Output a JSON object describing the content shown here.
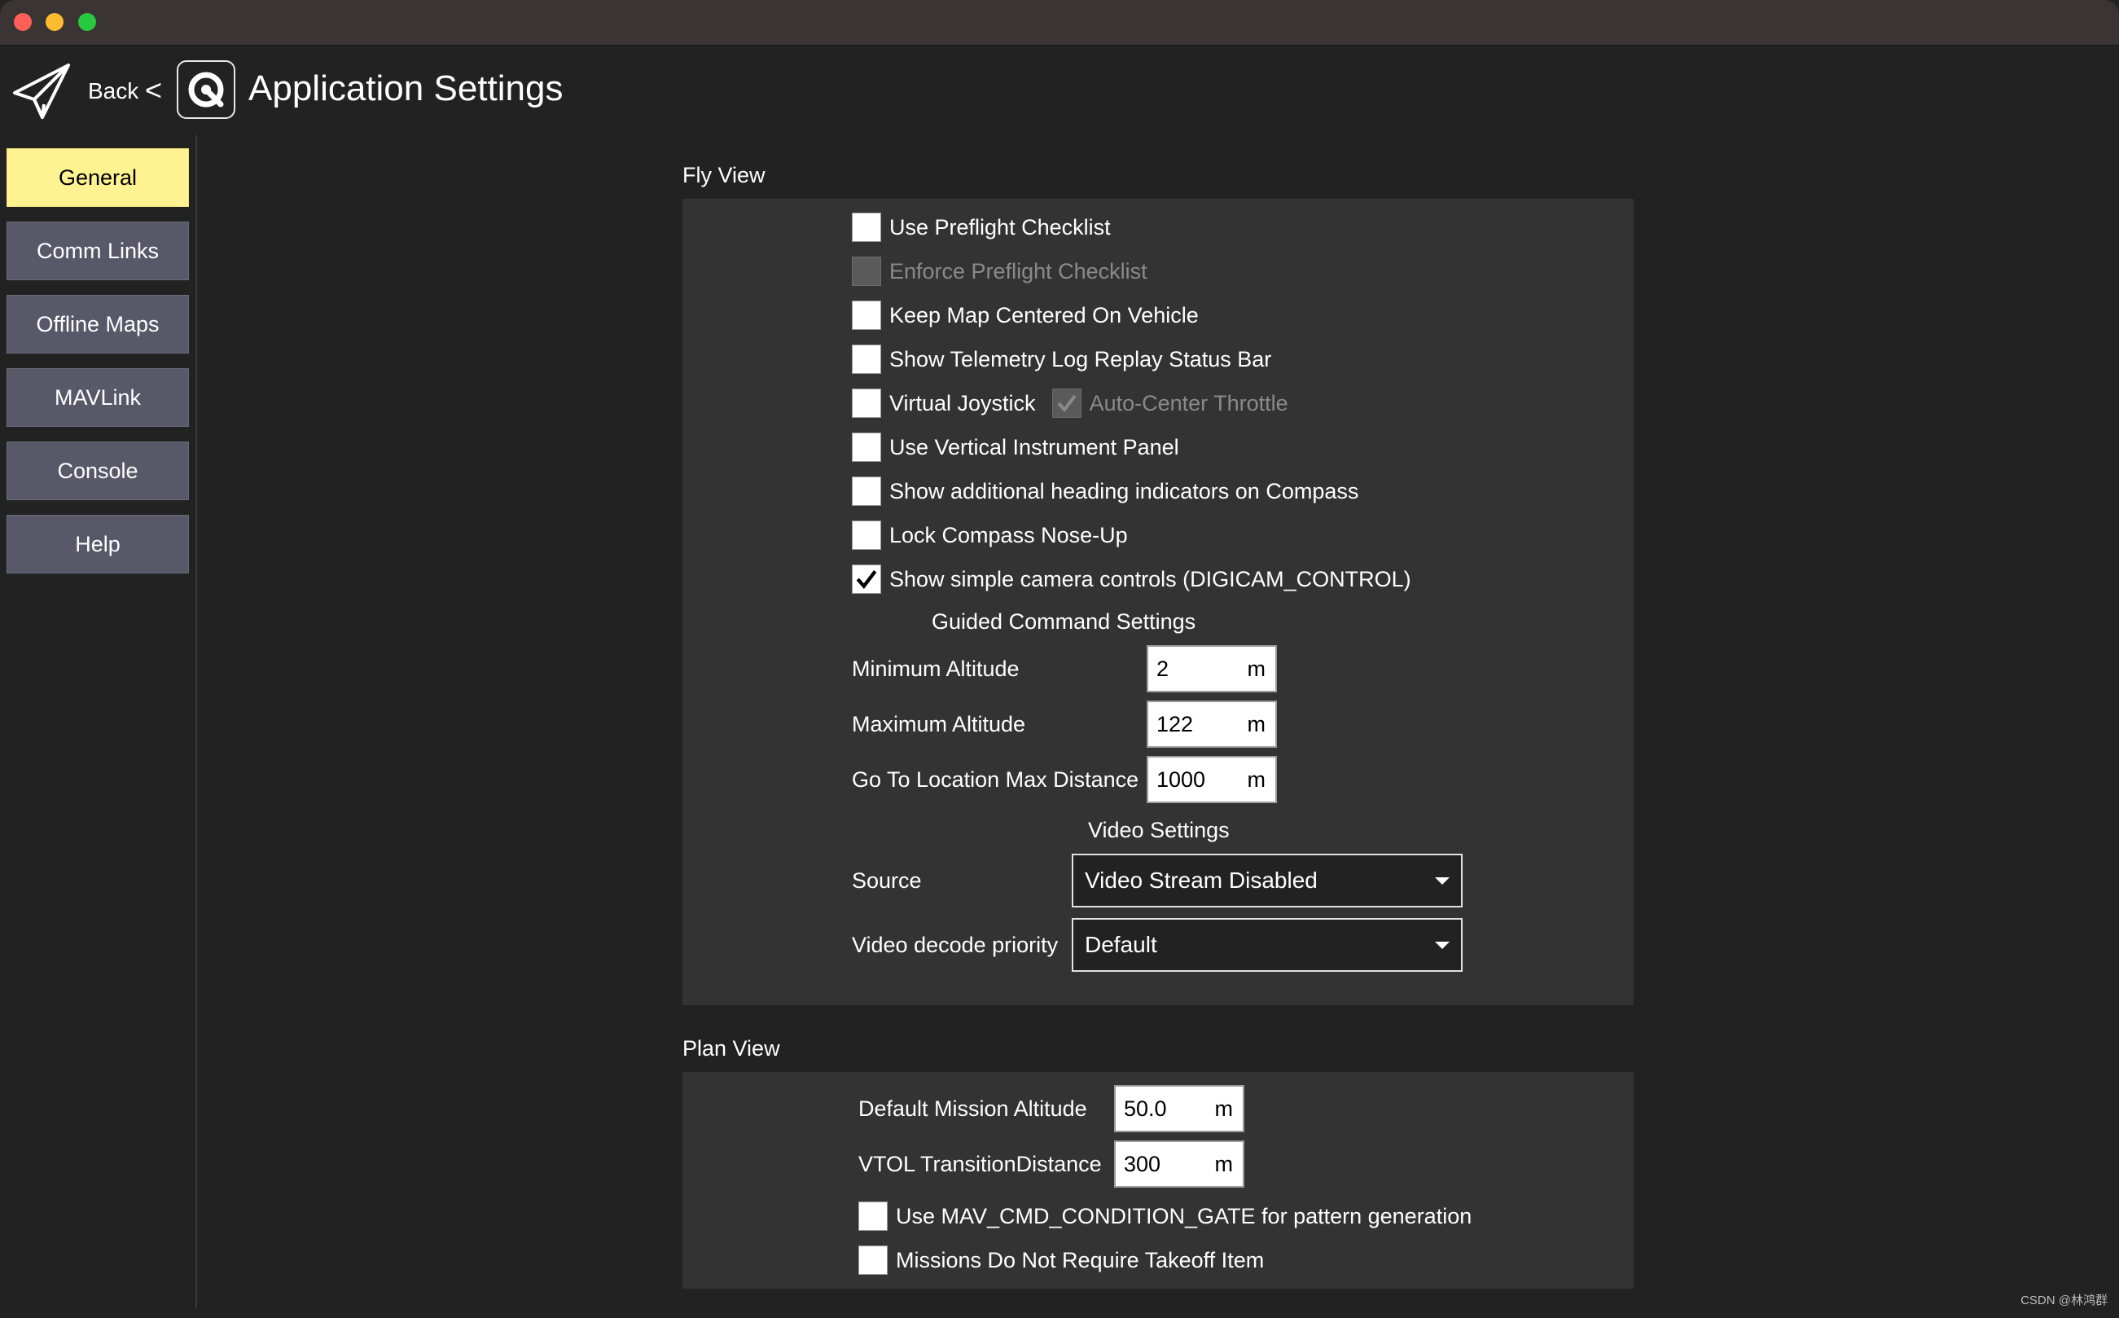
{
  "header": {
    "back_label": "Back",
    "separator": "<",
    "title": "Application Settings",
    "plane_icon": "paper-plane-icon",
    "app_icon": "qgc-logo-icon"
  },
  "sidebar": {
    "items": [
      {
        "label": "General",
        "active": true
      },
      {
        "label": "Comm Links",
        "active": false
      },
      {
        "label": "Offline Maps",
        "active": false
      },
      {
        "label": "MAVLink",
        "active": false
      },
      {
        "label": "Console",
        "active": false
      },
      {
        "label": "Help",
        "active": false
      }
    ]
  },
  "fly_view": {
    "title": "Fly View",
    "checkboxes": [
      {
        "label": "Use Preflight Checklist",
        "checked": false,
        "enabled": true
      },
      {
        "label": "Enforce Preflight Checklist",
        "checked": false,
        "enabled": false
      },
      {
        "label": "Keep Map Centered On Vehicle",
        "checked": false,
        "enabled": true
      },
      {
        "label": "Show Telemetry Log Replay Status Bar",
        "checked": false,
        "enabled": true
      },
      {
        "label": "Virtual Joystick",
        "checked": false,
        "enabled": true
      },
      {
        "label": "Use Vertical Instrument Panel",
        "checked": false,
        "enabled": true
      },
      {
        "label": "Show additional heading indicators on Compass",
        "checked": false,
        "enabled": true
      },
      {
        "label": "Lock Compass Nose-Up",
        "checked": false,
        "enabled": true
      },
      {
        "label": "Show simple camera controls (DIGICAM_CONTROL)",
        "checked": true,
        "enabled": true
      }
    ],
    "auto_center_throttle": {
      "label": "Auto-Center Throttle",
      "checked": true,
      "enabled": false
    },
    "guided": {
      "heading": "Guided Command Settings",
      "fields": [
        {
          "label": "Minimum Altitude",
          "value": "2",
          "unit": "m"
        },
        {
          "label": "Maximum Altitude",
          "value": "122",
          "unit": "m"
        },
        {
          "label": "Go To Location Max Distance",
          "value": "1000",
          "unit": "m"
        }
      ]
    },
    "video": {
      "heading": "Video Settings",
      "source_label": "Source",
      "source_value": "Video Stream Disabled",
      "decode_label": "Video decode priority",
      "decode_value": "Default"
    }
  },
  "plan_view": {
    "title": "Plan View",
    "fields": [
      {
        "label": "Default Mission Altitude",
        "value": "50.0",
        "unit": "m"
      },
      {
        "label": "VTOL TransitionDistance",
        "value": "300",
        "unit": "m"
      }
    ],
    "checkboxes": [
      {
        "label": "Use MAV_CMD_CONDITION_GATE for pattern generation",
        "checked": false
      },
      {
        "label": "Missions Do Not Require Takeoff Item",
        "checked": false
      }
    ]
  },
  "watermark": "CSDN @林鸿群",
  "colors": {
    "background": "#222222",
    "panel": "#333333",
    "nav_button": "#585869",
    "nav_active": "#fff291",
    "titlebar": "#3a3434"
  }
}
